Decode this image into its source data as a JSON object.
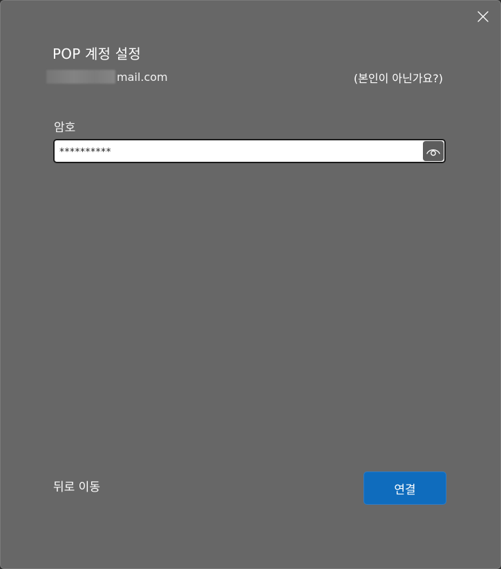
{
  "dialog": {
    "title": "POP 계정 설정",
    "email_visible_suffix": "mail.com",
    "not_you_link": "(본인이 아닌가요?)",
    "close_icon": "close-icon"
  },
  "password": {
    "label": "암호",
    "masked_value": "**********",
    "reveal_icon": "eye-icon"
  },
  "footer": {
    "back_label": "뒤로 이동",
    "connect_label": "연결"
  },
  "colors": {
    "dialog_bg": "#676767",
    "accent": "#0f6cbd",
    "input_bg": "#ffffff"
  }
}
